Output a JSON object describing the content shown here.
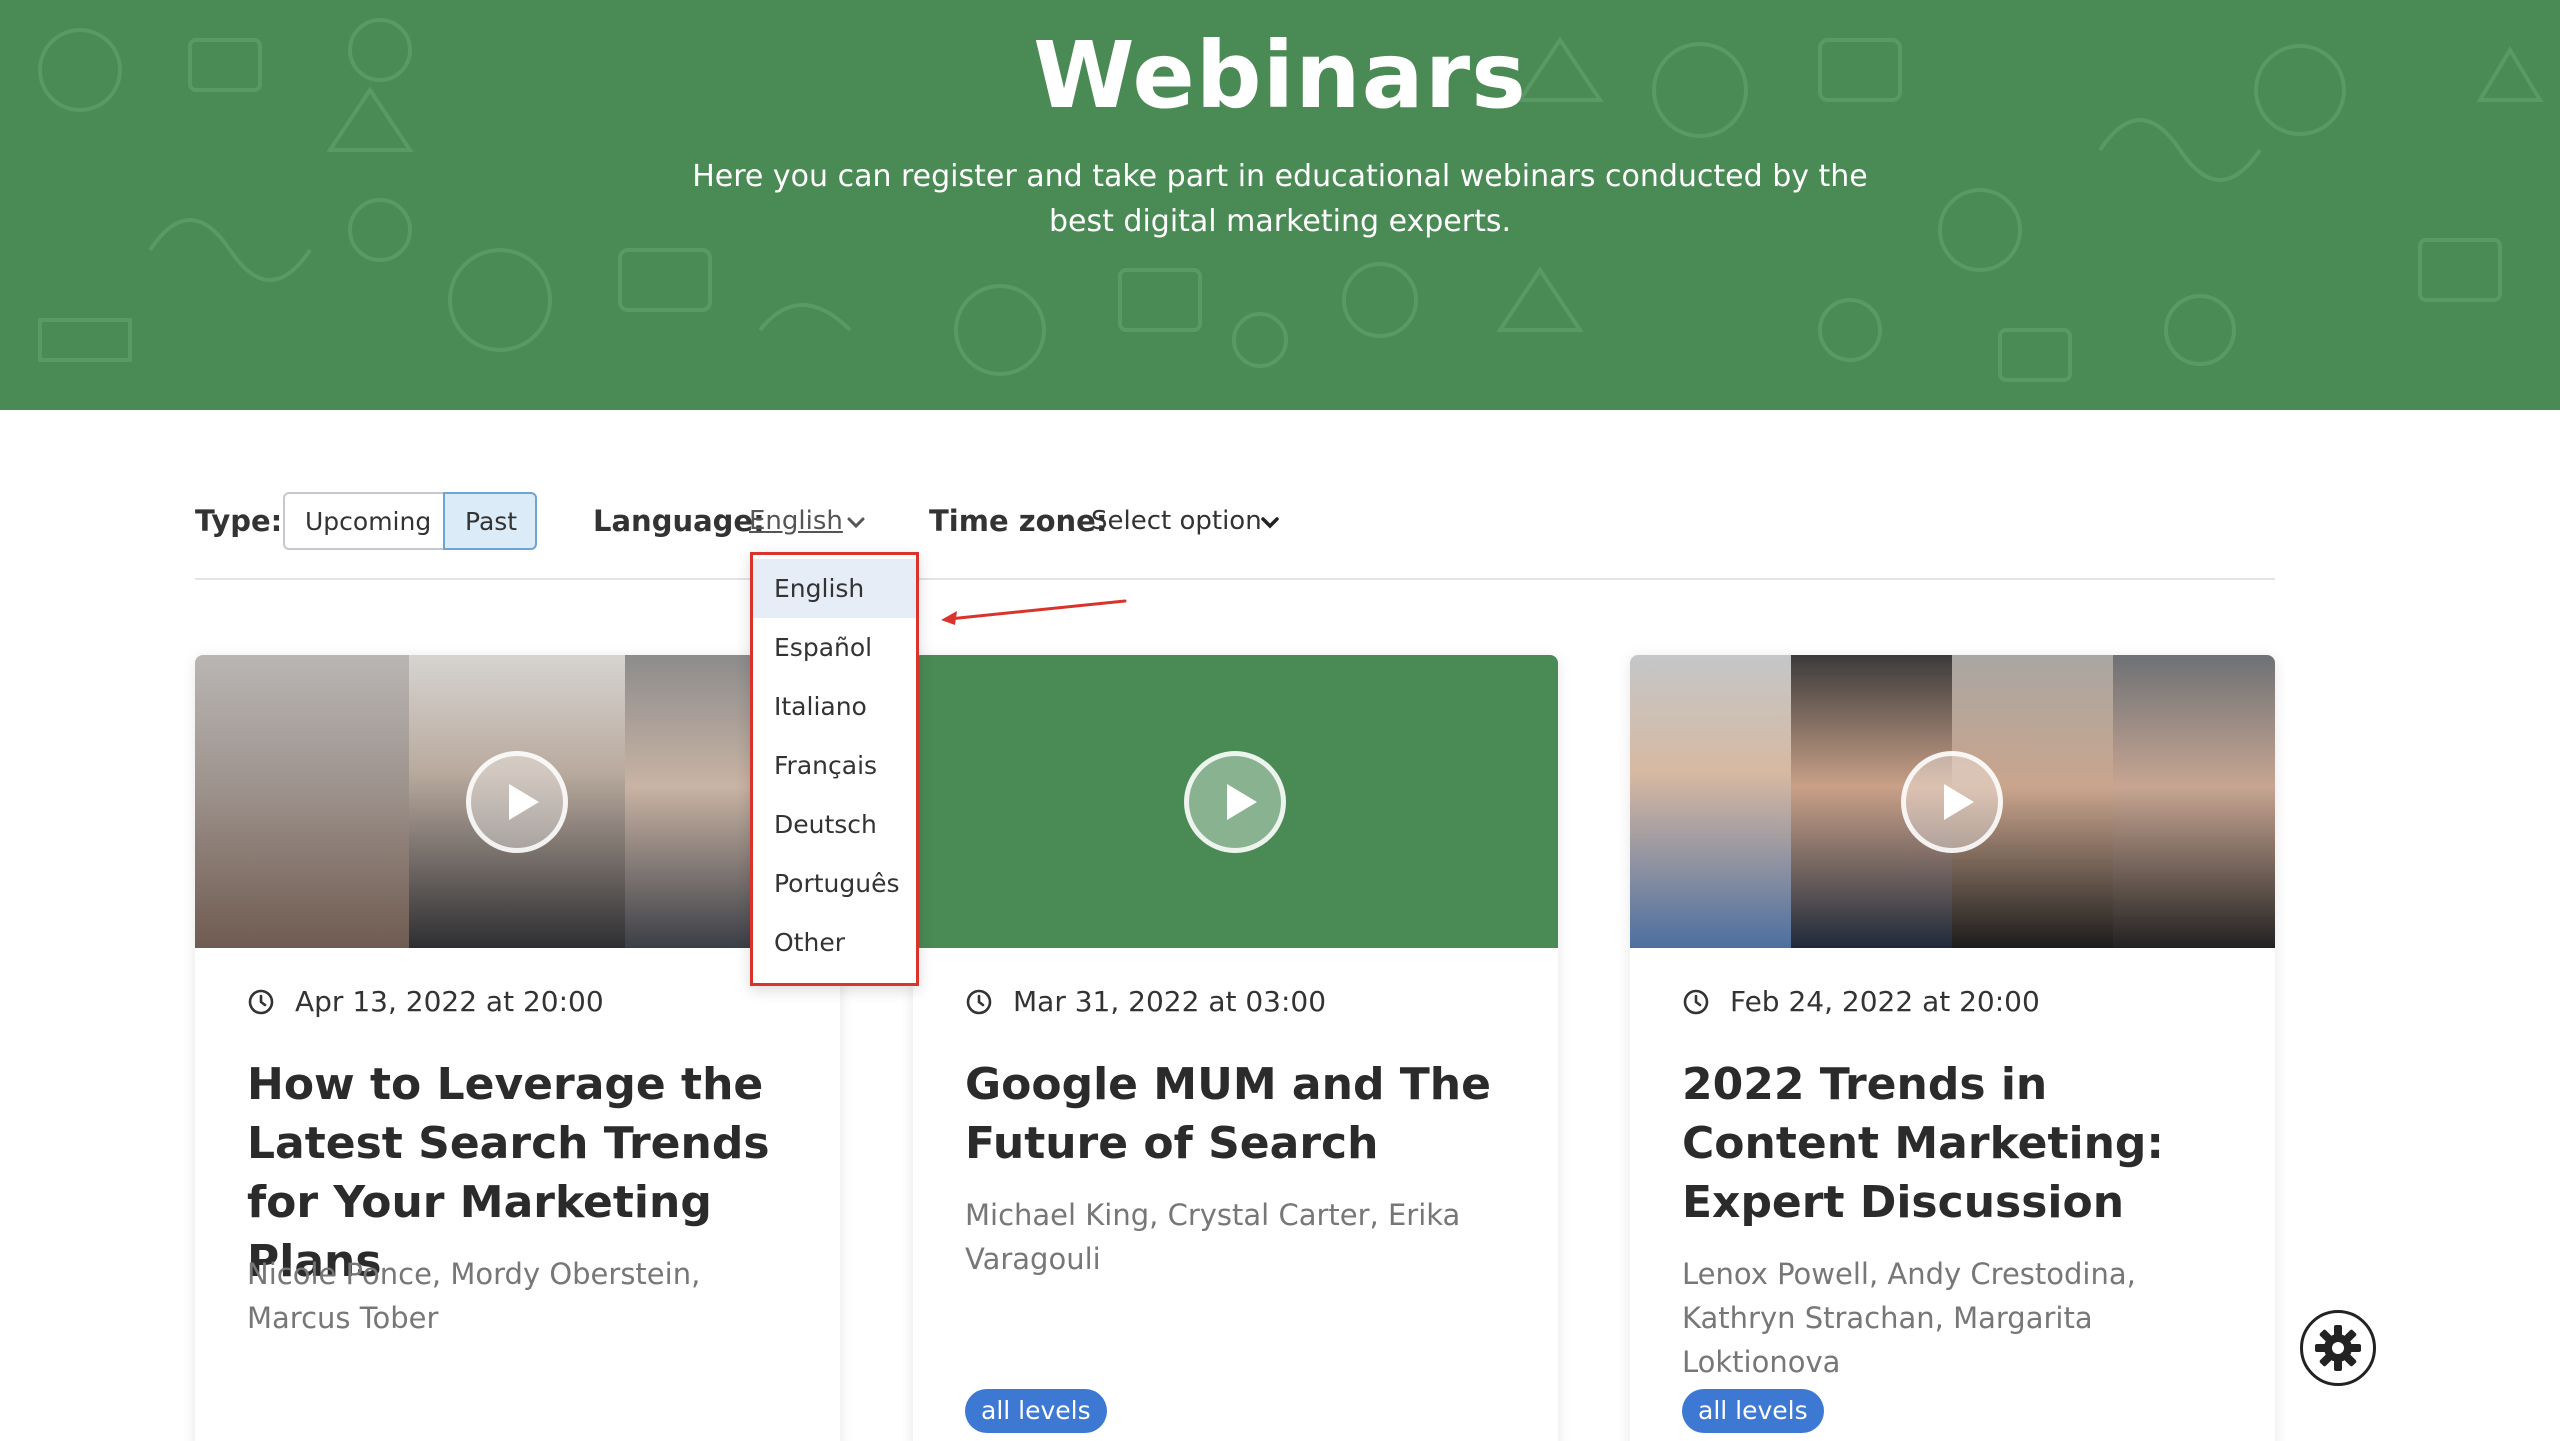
{
  "hero": {
    "title": "Webinars",
    "subtitle_line1": "Here you can register and take part in educational webinars conducted by the",
    "subtitle_line2": "best digital marketing experts."
  },
  "filters": {
    "type_label": "Type:",
    "type_options": [
      "Upcoming",
      "Past"
    ],
    "type_selected": "Past",
    "language_label": "Language:",
    "language_value": "English",
    "timezone_label": "Time zone:",
    "timezone_value": "Select option"
  },
  "language_menu": {
    "items": [
      "English",
      "Español",
      "Italiano",
      "Français",
      "Deutsch",
      "Português",
      "Other"
    ],
    "selected": "English"
  },
  "cards": [
    {
      "date": "Apr 13, 2022 at 20:00",
      "title": "How to Leverage the Latest Search Trends for Your Marketing Plans",
      "speakers": "Nicole Ponce, Mordy Oberstein, Marcus Tober",
      "badge": ""
    },
    {
      "date": "Mar 31, 2022 at 03:00",
      "title": "Google MUM and The Future of Search",
      "speakers": "Michael King, Crystal Carter, Erika Varagouli",
      "badge": "all levels"
    },
    {
      "date": "Feb 24, 2022 at 20:00",
      "title": "2022 Trends in Content Marketing: Expert Discussion",
      "speakers": "Lenox Powell, Andy Crestodina, Kathryn Strachan, Margarita Loktionova",
      "badge": "all levels"
    }
  ],
  "colors": {
    "hero_green": "#4a8a55",
    "badge_blue": "#3d79d3",
    "menu_border_red": "#d9342b",
    "selected_blue": "#dcebf8"
  },
  "icons": {
    "clock": "clock-icon",
    "play": "play-icon",
    "chevron": "chevron-down-icon",
    "gear": "gear-icon"
  }
}
